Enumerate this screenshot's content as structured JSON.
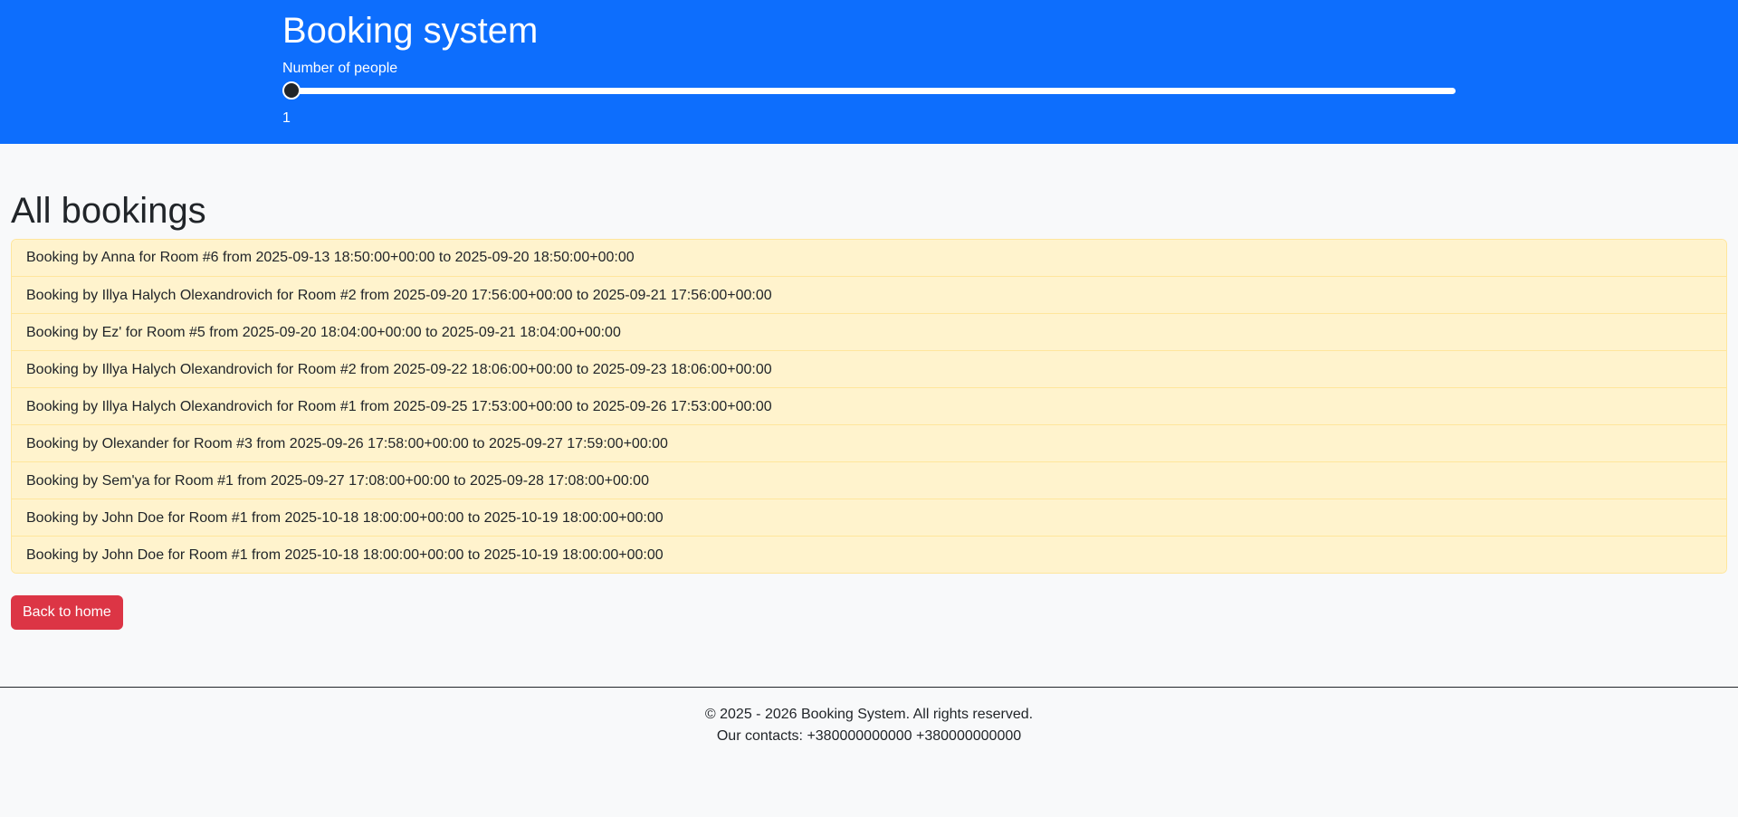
{
  "header": {
    "title": "Booking system",
    "slider_label": "Number of people",
    "slider_value": "1",
    "slider_min": 1,
    "slider_max": 20,
    "slider_fraction": 0.0
  },
  "main": {
    "title": "All bookings",
    "bookings": [
      "Booking by Anna for Room #6 from 2025-09-13 18:50:00+00:00 to 2025-09-20 18:50:00+00:00",
      "Booking by Illya Halych Olexandrovich for Room #2 from 2025-09-20 17:56:00+00:00 to 2025-09-21 17:56:00+00:00",
      "Booking by Ez' for Room #5 from 2025-09-20 18:04:00+00:00 to 2025-09-21 18:04:00+00:00",
      "Booking by Illya Halych Olexandrovich for Room #2 from 2025-09-22 18:06:00+00:00 to 2025-09-23 18:06:00+00:00",
      "Booking by Illya Halych Olexandrovich for Room #1 from 2025-09-25 17:53:00+00:00 to 2025-09-26 17:53:00+00:00",
      "Booking by Olexander for Room #3 from 2025-09-26 17:58:00+00:00 to 2025-09-27 17:59:00+00:00",
      "Booking by Sem'ya for Room #1 from 2025-09-27 17:08:00+00:00 to 2025-09-28 17:08:00+00:00",
      "Booking by John Doe for Room #1 from 2025-10-18 18:00:00+00:00 to 2025-10-19 18:00:00+00:00",
      "Booking by John Doe for Room #1 from 2025-10-18 18:00:00+00:00 to 2025-10-19 18:00:00+00:00"
    ],
    "back_button_label": "Back to home"
  },
  "footer": {
    "copyright": "© 2025 - 2026 Booking System. All rights reserved.",
    "contacts": "Our contacts: +380000000000 +380000000000"
  },
  "colors": {
    "header_bg": "#0d6efd",
    "page_bg": "#f8f9fa",
    "booking_bg": "#fff3cd",
    "booking_border": "#ffe69c",
    "back_button_bg": "#dc3545"
  }
}
